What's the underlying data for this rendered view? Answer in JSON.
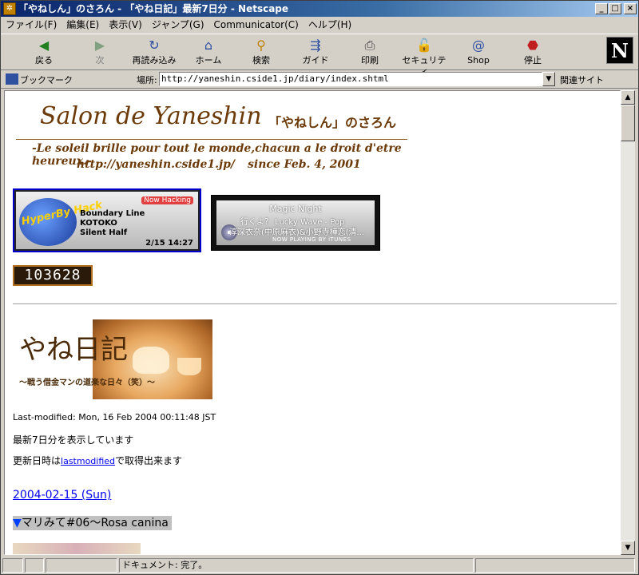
{
  "window": {
    "title": "「やねしん」のさろん - 「やね日記」最新7日分 - Netscape",
    "minimize": "_",
    "maximize": "□",
    "close": "×"
  },
  "menu": [
    "ファイル(F)",
    "編集(E)",
    "表示(V)",
    "ジャンプ(G)",
    "Communicator(C)",
    "ヘルプ(H)"
  ],
  "toolbar": {
    "back": "戻る",
    "forward": "次",
    "reload": "再読み込み",
    "home": "ホーム",
    "search": "検索",
    "guide": "ガイド",
    "print": "印刷",
    "security": "セキュリティ",
    "shop": "Shop",
    "stop": "停止",
    "logo": "N"
  },
  "location": {
    "bookmarks": "ブックマーク",
    "label": "場所:",
    "url": "http://yaneshin.cside1.jp/diary/index.shtml",
    "related": "関連サイト"
  },
  "page": {
    "banner": {
      "title": "Salon de Yaneshin",
      "title_jp": "「やねしん」のさろん",
      "motto": "-Le soleil brille pour tout le monde,chacun a le droit d'etre heureux.-",
      "url": "http://yaneshin.cside1.jp/",
      "since": "since Feb. 4, 2001"
    },
    "hacking": {
      "logo": "HyperBy Hack",
      "badge": "Now Hacking",
      "tracks": [
        "Boundary Line",
        "KOTOKO",
        "Silent Half"
      ],
      "time": "2/15 14:27"
    },
    "itunes": {
      "song": "Magic Night",
      "line2": "行くよ？ Lucky Wave - Pop",
      "line3": "淳深衣奈(中原麻衣)&小野寺樺恋(清...",
      "footer": "NOW PLAYING BY iTUNES"
    },
    "counter": "103628",
    "diary_logo": {
      "title": "やね日記",
      "subtitle": "〜戦う借金マンの道楽な日々（笑）〜"
    },
    "last_modified": "Last-modified: Mon, 16 Feb 2004 00:11:48 JST",
    "showing": "最新7日分を表示しています",
    "update_prefix": "更新日時は",
    "update_link": "lastmodified",
    "update_suffix": "で取得出来ます",
    "entry_date": "2004-02-15 (Sun)",
    "entry_marker": "▼",
    "entry_title": "マリみて#06〜Rosa canina"
  },
  "status": {
    "text": "ドキュメント: 完了。"
  },
  "colors": {
    "banner_text": "#6b3a08",
    "link": "#0000ee",
    "titlebar": "#0a246a"
  }
}
